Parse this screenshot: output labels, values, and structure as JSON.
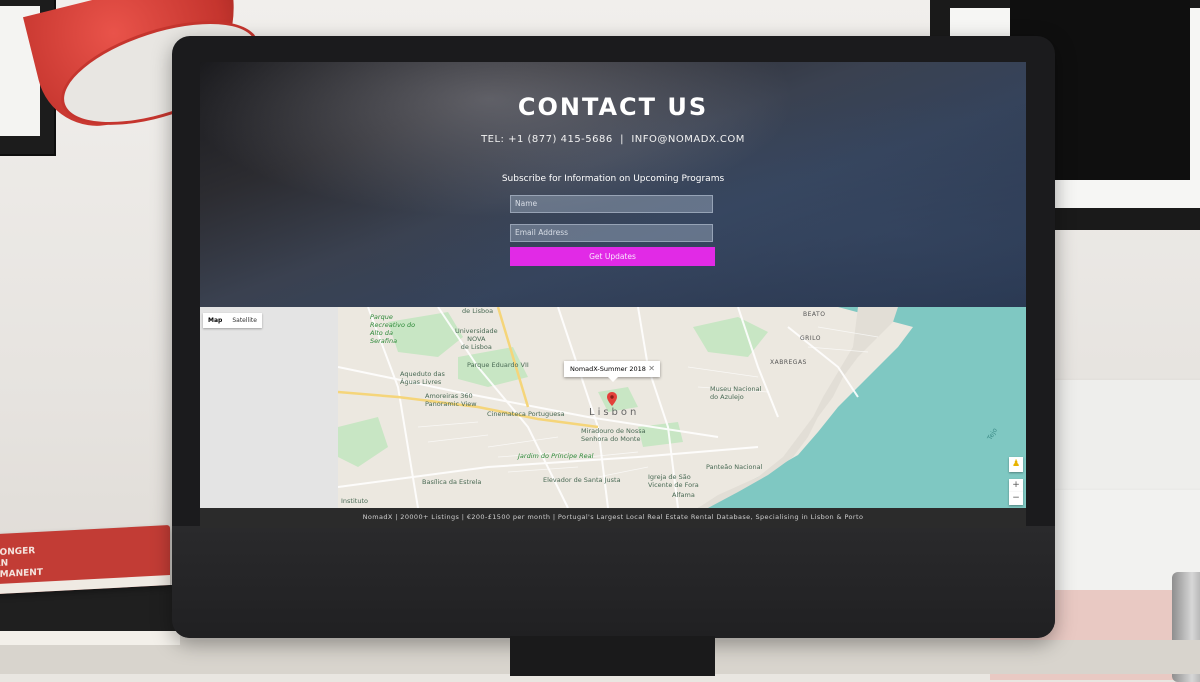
{
  "contact": {
    "title": "CONTACT US",
    "contact_line": "TEL: +1 (877) 415-5686  |  INFO@NOMADX.COM",
    "subscribe_text": "Subscribe for Information on Upcoming Programs",
    "name_placeholder": "Name",
    "email_placeholder": "Email Address",
    "button_label": "Get Updates",
    "button_color": "#e12ae6"
  },
  "map": {
    "toggle": {
      "map_label": "Map",
      "satellite_label": "Satellite",
      "selected": "Map"
    },
    "infowindow_text": "NomadX-Summer 2018",
    "close_glyph": "✕",
    "zoom_in_label": "+",
    "zoom_out_label": "−",
    "labels": {
      "parque": "Parque\nRecreativo do\nAlto da\nSerafina",
      "universidade": "Universidade\nNOVA\nde Lisboa",
      "de_lisboa": "de Lisboa",
      "parque_eduardo": "Parque Eduardo VII",
      "aqueduto": "Aqueduto das\nÁguas Livres",
      "amoreiras": "Amoreiras 360\nPanoramic View",
      "cinemateca": "Cinemateca Portuguesa",
      "lisbon": "Lisbon",
      "miradouro": "Miradouro de Nossa\nSenhora do Monte",
      "jardim": "Jardim do Príncipe Real",
      "basilica": "Basílica da Estrela",
      "elevador": "Elevador de Santa Justa",
      "igreja": "Igreja de São\nVicente de Fora",
      "panteao": "Panteão Nacional",
      "museu": "Museu Nacional\ndo Azulejo",
      "beato": "BEATO",
      "grilo": "GRILO",
      "xabregas": "XABREGAS",
      "alfama": "Alfama",
      "instituto": "Instituto",
      "tejo": "Tejo"
    }
  },
  "footer": {
    "text": "NomadX | 20000+ Listings | €200-£1500 per month | Portugal's Largest Local Real Estate Rental Database, Specialising in Lisbon & Porto"
  },
  "desk": {
    "book_text": "STRONGER\nTHAN\nPERMANENT"
  }
}
